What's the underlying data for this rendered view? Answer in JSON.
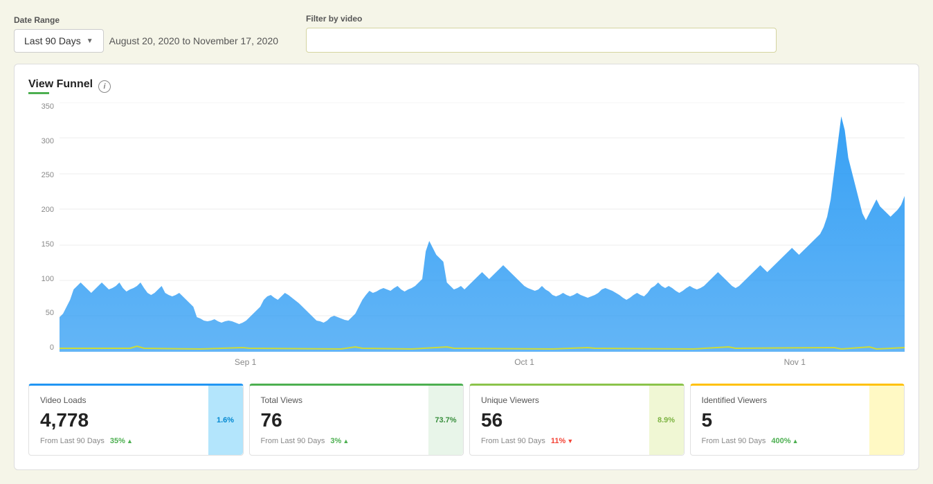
{
  "controls": {
    "date_range_label": "Date Range",
    "date_range_value": "Last 90 Days",
    "date_range_text": "August 20, 2020 to November 17, 2020",
    "filter_label": "Filter by video",
    "filter_placeholder": ""
  },
  "chart": {
    "title": "View Funnel",
    "y_labels": [
      "350",
      "300",
      "250",
      "200",
      "150",
      "100",
      "50",
      "0"
    ],
    "x_labels": [
      {
        "label": "Sep 1",
        "pct": "22"
      },
      {
        "label": "Oct 1",
        "pct": "55"
      },
      {
        "label": "Nov 1",
        "pct": "87"
      }
    ]
  },
  "metrics": [
    {
      "name": "Video Loads",
      "value": "4,778",
      "footer_label": "From Last 90 Days",
      "change": "35%",
      "change_dir": "up",
      "bar_value": "1.6%",
      "bar_color": "blue"
    },
    {
      "name": "Total Views",
      "value": "76",
      "footer_label": "From Last 90 Days",
      "change": "3%",
      "change_dir": "up",
      "bar_value": "73.7%",
      "bar_color": "green"
    },
    {
      "name": "Unique Viewers",
      "value": "56",
      "footer_label": "From Last 90 Days",
      "change": "11%",
      "change_dir": "down",
      "bar_value": "8.9%",
      "bar_color": "yellow-green"
    },
    {
      "name": "Identified Viewers",
      "value": "5",
      "footer_label": "From Last 90 Days",
      "change": "400%",
      "change_dir": "up",
      "bar_value": "",
      "bar_color": "yellow"
    }
  ]
}
